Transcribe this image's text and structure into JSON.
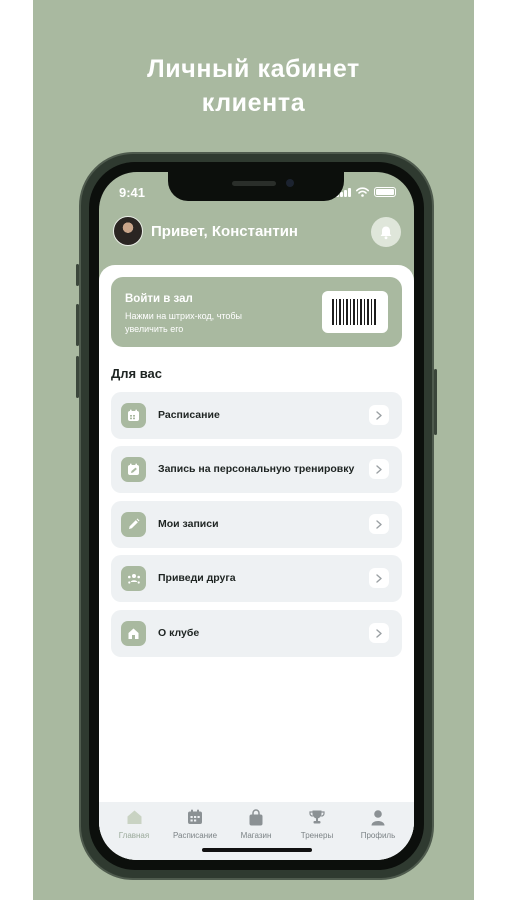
{
  "headline": {
    "line1": "Личный кабинет",
    "line2": "клиента"
  },
  "status_bar": {
    "time": "9:41"
  },
  "header": {
    "greeting": "Привет, Константин",
    "avatar_icon": "avatar",
    "bell_icon": "bell-icon"
  },
  "gym_card": {
    "title": "Войти в зал",
    "subtitle": "Нажми на штрих-код, чтобы увеличить его",
    "barcode_icon": "barcode-icon"
  },
  "section_title": "Для вас",
  "menu": [
    {
      "label": "Расписание",
      "icon": "calendar-icon"
    },
    {
      "label": "Запись на персональную тренировку",
      "icon": "calendar-edit-icon"
    },
    {
      "label": "Мои записи",
      "icon": "pencil-icon"
    },
    {
      "label": "Приведи друга",
      "icon": "friends-icon"
    },
    {
      "label": "О клубе",
      "icon": "club-icon"
    }
  ],
  "tabbar": [
    {
      "label": "Главная",
      "icon": "home-icon",
      "active": true
    },
    {
      "label": "Расписание",
      "icon": "calendar-icon",
      "active": false
    },
    {
      "label": "Магазин",
      "icon": "shopping-bag-icon",
      "active": false
    },
    {
      "label": "Тренеры",
      "icon": "trophy-icon",
      "active": false
    },
    {
      "label": "Профиль",
      "icon": "person-icon",
      "active": false
    }
  ],
  "colors": {
    "accent": "#a9b9a0",
    "row_bg": "#eef1f3",
    "text_dark": "#1e2422",
    "tab_text": "#7c8386"
  }
}
